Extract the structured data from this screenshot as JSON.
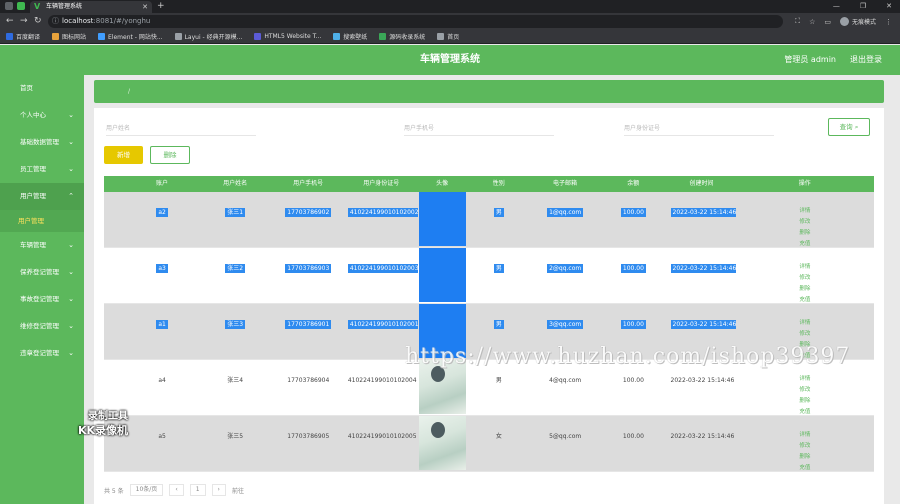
{
  "browser": {
    "tab_title": "车辆管理系统",
    "url_host": "localhost",
    "url_path": ":8081/#/yonghu",
    "profile": "无痕模式",
    "bookmarks": [
      {
        "label": "百度翻译",
        "color": "#2f6be0"
      },
      {
        "label": "图标网站",
        "color": "#e8a33c"
      },
      {
        "label": "Element - 网站快...",
        "color": "#409eff"
      },
      {
        "label": "Layui - 经典开源模...",
        "color": "#9aa0a6"
      },
      {
        "label": "HTML5 Website T...",
        "color": "#5b5bd6"
      },
      {
        "label": "搜索壁纸",
        "color": "#4fb0e8"
      },
      {
        "label": "源码收录系统",
        "color": "#3aa757"
      },
      {
        "label": "首页",
        "color": "#9aa0a6"
      }
    ]
  },
  "header": {
    "title": "车辆管理系统",
    "user": "管理员 admin",
    "logout": "退出登录"
  },
  "sidebar": {
    "items": [
      {
        "label": "首页",
        "chev": ""
      },
      {
        "label": "个人中心",
        "chev": "⌄"
      },
      {
        "label": "基础数据管理",
        "chev": "⌄"
      },
      {
        "label": "员工管理",
        "chev": "⌄"
      },
      {
        "label": "用户管理",
        "chev": "⌃"
      },
      {
        "label": "车辆管理",
        "chev": "⌄"
      },
      {
        "label": "保养登记管理",
        "chev": "⌄"
      },
      {
        "label": "事故登记管理",
        "chev": "⌄"
      },
      {
        "label": "维修登记管理",
        "chev": "⌄"
      },
      {
        "label": "违章登记管理",
        "chev": "⌄"
      }
    ],
    "sub_item": "用户管理"
  },
  "main": {
    "breadcrumb": "/",
    "search_button": "查询",
    "search_fields": [
      "用户姓名",
      "用户手机号",
      "用户身份证号"
    ],
    "add_button": "新增",
    "delete_button": "删除",
    "columns": [
      "",
      "账户",
      "用户姓名",
      "用户手机号",
      "用户身份证号",
      "头像",
      "性别",
      "电子邮箱",
      "余额",
      "创建时间",
      "操作"
    ],
    "rows": [
      {
        "cells": [
          "",
          "a2",
          "张三1",
          "17703786902",
          "410224199010102002",
          "",
          "男",
          "1@qq.com",
          "100.00",
          "2022-03-22 15:14:46",
          ""
        ],
        "photo": "blue",
        "selected": true
      },
      {
        "cells": [
          "",
          "a3",
          "张三2",
          "17703786903",
          "410224199010102003",
          "",
          "男",
          "2@qq.com",
          "100.00",
          "2022-03-22 15:14:46",
          ""
        ],
        "photo": "blue",
        "selected": true
      },
      {
        "cells": [
          "",
          "a1",
          "张三3",
          "17703786901",
          "410224199010102001",
          "",
          "男",
          "3@qq.com",
          "100.00",
          "2022-03-22 15:14:46",
          ""
        ],
        "photo": "blue",
        "selected": true
      },
      {
        "cells": [
          "",
          "a4",
          "张三4",
          "17703786904",
          "410224199010102004",
          "",
          "男",
          "4@qq.com",
          "100.00",
          "2022-03-22 15:14:46",
          ""
        ],
        "photo": "pic",
        "selected": false
      },
      {
        "cells": [
          "",
          "a5",
          "张三5",
          "17703786905",
          "410224199010102005",
          "",
          "女",
          "5@qq.com",
          "100.00",
          "2022-03-22 15:14:46",
          ""
        ],
        "photo": "pic",
        "selected": false
      }
    ],
    "actions": [
      "详情",
      "修改",
      "删除",
      "充值"
    ],
    "pager": {
      "total": "共 5 条",
      "page_size": "10条/页",
      "prev": "‹",
      "page": "1",
      "next": "›",
      "goto": "前往"
    }
  },
  "overlay": {
    "watermark": "https://www.huzhan.com/ishop39397",
    "rec_line1": "录制工具",
    "rec_line2": "KK录像机"
  }
}
